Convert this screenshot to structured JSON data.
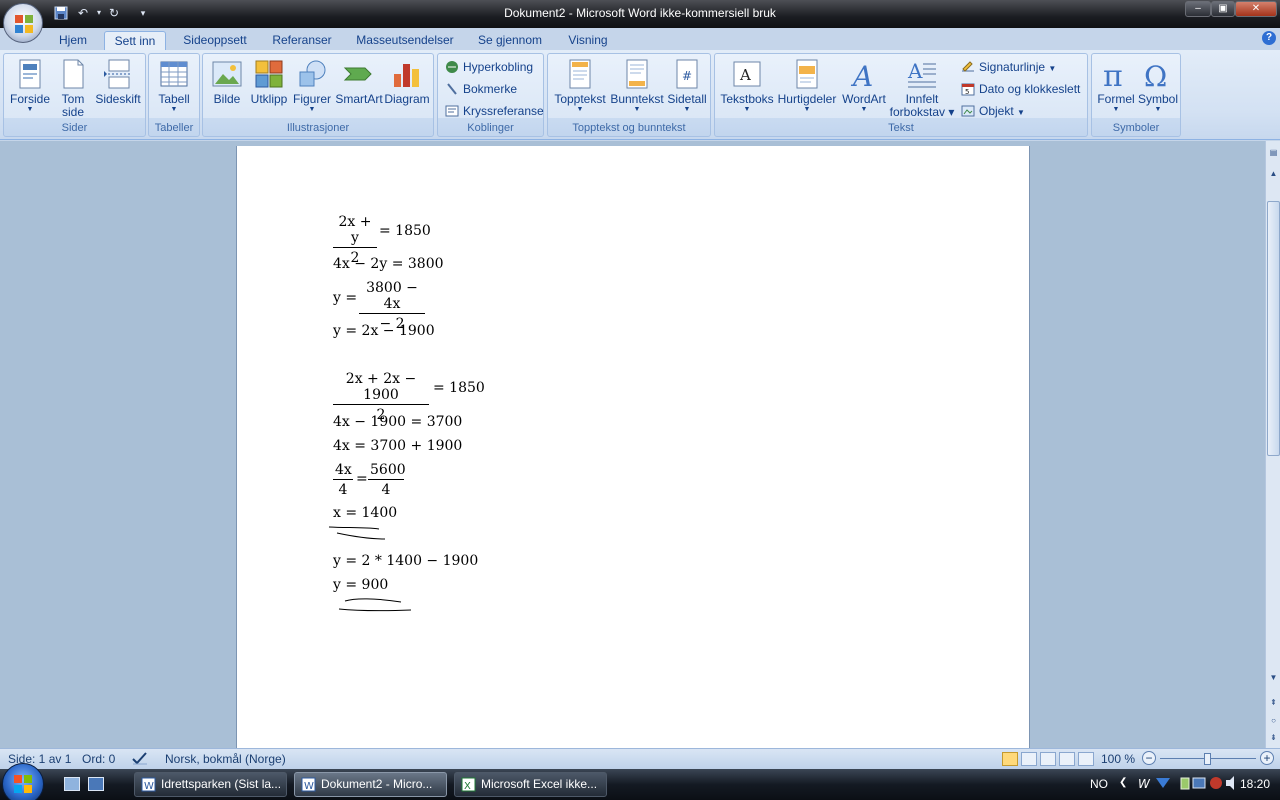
{
  "window": {
    "title": "Dokument2 - Microsoft Word ikke-kommersiell bruk",
    "minimize": "‒",
    "maximize": "▣",
    "close": "✕"
  },
  "quick_access": {
    "save_icon": "save-icon",
    "undo_icon": "undo-icon",
    "redo_icon": "redo-icon",
    "customize_icon": "customize-icon"
  },
  "tabs": [
    "Hjem",
    "Sett inn",
    "Sideoppsett",
    "Referanser",
    "Masseutsendelser",
    "Se gjennom",
    "Visning"
  ],
  "help_label": "?",
  "ribbon": {
    "sider": {
      "label": "Sider",
      "buttons": [
        "Forside",
        "Tom side",
        "Sideskift"
      ]
    },
    "tabeller": {
      "label": "Tabeller",
      "buttons": [
        "Tabell"
      ]
    },
    "illustrasjoner": {
      "label": "Illustrasjoner",
      "buttons": [
        "Bilde",
        "Utklipp",
        "Figurer",
        "SmartArt",
        "Diagram"
      ]
    },
    "koblinger": {
      "label": "Koblinger",
      "buttons": [
        "Hyperkobling",
        "Bokmerke",
        "Kryssreferanse"
      ]
    },
    "topptekst": {
      "label": "Topptekst og bunntekst",
      "buttons": [
        "Topptekst",
        "Bunntekst",
        "Sidetall"
      ]
    },
    "tekst": {
      "label": "Tekst",
      "buttons": [
        "Tekstboks",
        "Hurtigdeler",
        "WordArt",
        "Innfelt",
        "forbokstav"
      ],
      "small": [
        "Signaturlinje",
        "Dato og klokkeslett",
        "Objekt"
      ]
    },
    "symboler": {
      "label": "Symboler",
      "buttons": [
        "Formel",
        "Symbol"
      ]
    }
  },
  "document": {
    "eq1": {
      "num": "2x + y",
      "den": "2",
      "rhs": "= 1850"
    },
    "eq2": "4x − 2y = 3800",
    "eq3": {
      "lhs": "y =",
      "num": "3800 − 4x",
      "den": "− 2"
    },
    "eq4": "y = 2x − 1900",
    "eq5": {
      "num": "2x + 2x − 1900",
      "den": "2",
      "rhs": "= 1850"
    },
    "eq6": "4x − 1900 = 3700",
    "eq7": "4x = 3700 + 1900",
    "eq8": {
      "num1": "4x",
      "den1": "4",
      "eq": "=",
      "num2": "5600",
      "den2": "4"
    },
    "eq9": "x = 1400",
    "eq10": "y = 2 * 1400 − 1900",
    "eq11": "y = 900"
  },
  "statusbar": {
    "page": "Side: 1 av 1",
    "words": "Ord: 0",
    "language": "Norsk, bokmål (Norge)",
    "zoom": "100 %",
    "zoom_minus": "−",
    "zoom_plus": "+"
  },
  "taskbar": {
    "tasks": [
      "Idrettsparken (Sist la...",
      "Dokument2 - Micro...",
      "Microsoft Excel ikke..."
    ],
    "lang": "NO",
    "clock": "18:20"
  },
  "colors": {
    "ribbon_bg": "#dbe7f6",
    "accent": "#15428b",
    "doc_bg": "#a9bfd6"
  }
}
